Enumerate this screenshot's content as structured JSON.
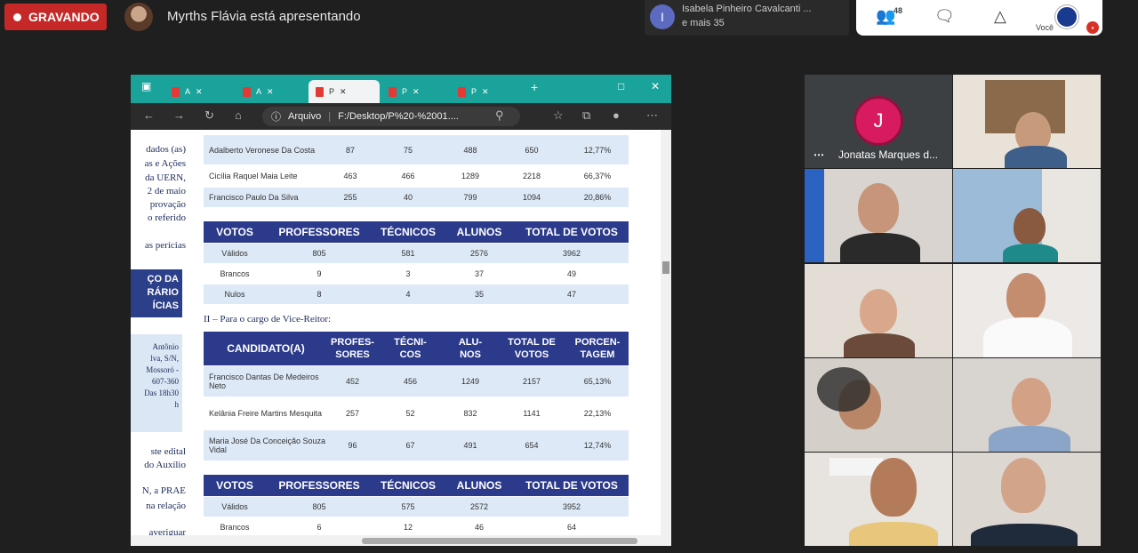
{
  "recording": {
    "label": "GRAVANDO"
  },
  "presenter": {
    "text": "Myrths Flávia está apresentando"
  },
  "participants_box": {
    "initial": "I",
    "name": "Isabela Pinheiro Cavalcanti ...",
    "more": "e mais 35"
  },
  "top_panel": {
    "people_count": "48",
    "you_label": "Você"
  },
  "browser": {
    "tabs": [
      {
        "label": "A",
        "active": false
      },
      {
        "label": "A",
        "active": false
      },
      {
        "label": "P",
        "active": true
      },
      {
        "label": "P",
        "active": false
      },
      {
        "label": "P",
        "active": false
      }
    ],
    "url_prefix": "Arquivo",
    "url": "F:/Desktop/P%20-%2001...."
  },
  "pdf": {
    "left_text": [
      "dados (as)",
      "as e Ações",
      "da UERN,",
      "2 de maio",
      "provação",
      "o referido",
      "as perícias"
    ],
    "left_box": [
      "ÇO DA",
      "RÁRIO",
      "ÍCIAS"
    ],
    "left_address": [
      "Antônio",
      "lva, S/N,",
      "Mossoró -",
      "607-360",
      "Das 18h30",
      "h"
    ],
    "left_text2": [
      "ste edital",
      "do Auxílio",
      "N, a PRAE",
      "na relação",
      "averiguar"
    ],
    "table1_rows": [
      {
        "name": "Adalberto Veronese Da Costa",
        "prof": "87",
        "tec": "75",
        "alu": "488",
        "total": "650",
        "pct": "12,77%"
      },
      {
        "name": "Cicília Raquel Maia Leite",
        "prof": "463",
        "tec": "466",
        "alu": "1289",
        "total": "2218",
        "pct": "66,37%"
      },
      {
        "name": "Francisco Paulo Da Silva",
        "prof": "255",
        "tec": "40",
        "alu": "799",
        "total": "1094",
        "pct": "20,86%"
      }
    ],
    "votes_header": {
      "votos": "VOTOS",
      "prof": "PROFESSORES",
      "tec": "TÉCNICOS",
      "alu": "ALUNOS",
      "total": "TOTAL DE VOTOS"
    },
    "votes1": [
      {
        "label": "Válidos",
        "prof": "805",
        "tec": "581",
        "alu": "2576",
        "total": "3962"
      },
      {
        "label": "Brancos",
        "prof": "9",
        "tec": "3",
        "alu": "37",
        "total": "49"
      },
      {
        "label": "Nulos",
        "prof": "8",
        "tec": "4",
        "alu": "35",
        "total": "47"
      }
    ],
    "section2": "II – Para o cargo de Vice-Reitor:",
    "cand_header": {
      "cand": "CANDIDATO(A)",
      "prof": "PROFES-\nSORES",
      "tec": "TÉCNI-\nCOS",
      "alu": "ALU-\nNOS",
      "total": "TOTAL DE\nVOTOS",
      "pct": "PORCEN-\nTAGEM"
    },
    "table2_rows": [
      {
        "name": "Francisco Dantas De Medeiros Neto",
        "prof": "452",
        "tec": "456",
        "alu": "1249",
        "total": "2157",
        "pct": "65,13%"
      },
      {
        "name": "Kelânia Freire Martins Mesquita",
        "prof": "257",
        "tec": "52",
        "alu": "832",
        "total": "1141",
        "pct": "22,13%"
      },
      {
        "name": "Maria José Da Conceição Souza Vidal",
        "prof": "96",
        "tec": "67",
        "alu": "491",
        "total": "654",
        "pct": "12,74%"
      }
    ],
    "votes2": [
      {
        "label": "Válidos",
        "prof": "805",
        "tec": "575",
        "alu": "2572",
        "total": "3952"
      },
      {
        "label": "Brancos",
        "prof": "6",
        "tec": "12",
        "alu": "46",
        "total": "64"
      }
    ]
  },
  "tiles": {
    "jonatas_initial": "J",
    "jonatas_name": "Jonatas Marques d..."
  }
}
